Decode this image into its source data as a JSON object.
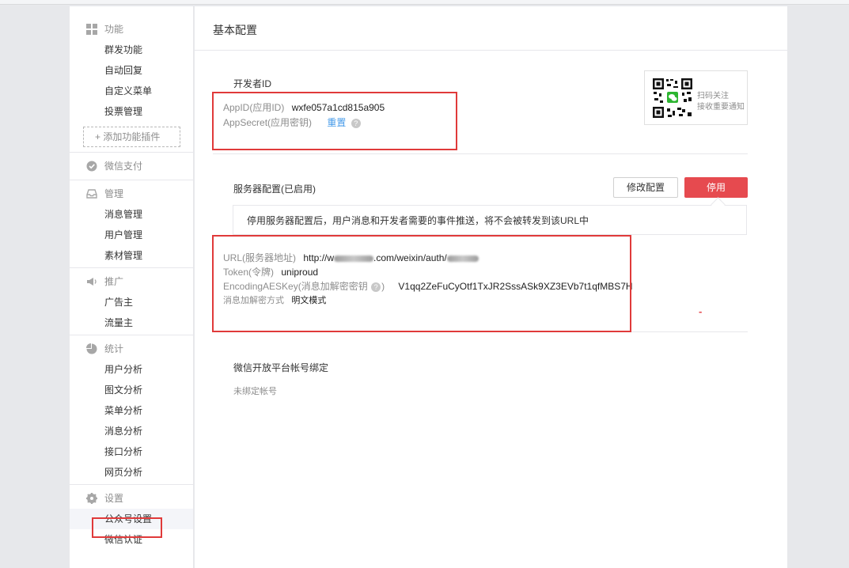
{
  "sidebar": {
    "function": {
      "title": "功能",
      "items": [
        "群发功能",
        "自动回复",
        "自定义菜单",
        "投票管理"
      ],
      "add_plugin": "+ 添加功能插件"
    },
    "pay": {
      "title": "微信支付"
    },
    "manage": {
      "title": "管理",
      "items": [
        "消息管理",
        "用户管理",
        "素材管理"
      ]
    },
    "promo": {
      "title": "推广",
      "items": [
        "广告主",
        "流量主"
      ]
    },
    "stats": {
      "title": "统计",
      "items": [
        "用户分析",
        "图文分析",
        "菜单分析",
        "消息分析",
        "接口分析",
        "网页分析"
      ]
    },
    "settings": {
      "title": "设置",
      "items": [
        "公众号设置",
        "微信认证"
      ]
    }
  },
  "main": {
    "title": "基本配置",
    "developer": {
      "title": "开发者ID",
      "appid_label": "AppID(应用ID)",
      "appid_value": "wxfe057a1cd815a905",
      "secret_label": "AppSecret(应用密钥)",
      "secret_link": "重置",
      "help": "?"
    },
    "qr": {
      "line1": "扫码关注",
      "line2": "接收重要通知"
    },
    "server": {
      "title": "服务器配置(已启用)",
      "modify_button": "修改配置",
      "stop_button": "停用",
      "notice": "停用服务器配置后，用户消息和开发者需要的事件推送，将不会被转发到该URL中",
      "url_label": "URL(服务器地址)",
      "url_value_prefix": "http://w",
      "url_value_suffix": ".com/weixin/auth/",
      "token_label": "Token(令牌)",
      "token_value": "uniproud",
      "aes_label": "EncodingAESKey(消息加解密密钥",
      "aes_label_end": ")",
      "aes_value": "V1qq2ZeFuCyOtf1TxJR2SssASk9XZ3EVb7t1qfMBS7H",
      "mode_label": "消息加解密方式",
      "mode_value": "明文模式",
      "dash": "-"
    },
    "open_platform": {
      "title": "微信开放平台帐号绑定",
      "status": "未绑定帐号"
    }
  },
  "colors": {
    "accent_red": "#e64a4f",
    "highlight_red": "#e03a3a",
    "link_blue": "#459ae9"
  }
}
